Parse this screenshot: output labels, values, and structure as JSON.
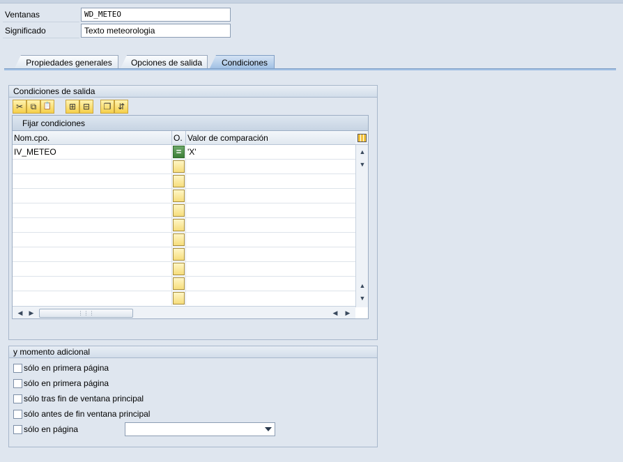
{
  "header": {
    "fields": [
      {
        "label": "Ventanas",
        "value": "WD_METEO"
      },
      {
        "label": "Significado",
        "value": "Texto meteorologia"
      }
    ]
  },
  "tabs": [
    {
      "label": "Propiedades generales",
      "active": false
    },
    {
      "label": "Opciones de salida",
      "active": false
    },
    {
      "label": "Condiciones",
      "active": true
    }
  ],
  "conditions": {
    "group_title": "Condiciones de salida",
    "toolbar": [
      {
        "name": "cut-icon",
        "glyph": "✂"
      },
      {
        "name": "copy-icon",
        "glyph": "⧉"
      },
      {
        "name": "paste-icon",
        "glyph": "📋"
      },
      {
        "name": "insert-row-icon",
        "glyph": "⊞"
      },
      {
        "name": "delete-row-icon",
        "glyph": "⊟"
      },
      {
        "name": "duplicate-icon",
        "glyph": "❐"
      },
      {
        "name": "move-icon",
        "glyph": "⇵"
      }
    ],
    "grid": {
      "title": "Fijar condiciones",
      "columns": [
        "Nom.cpo.",
        "O.",
        "Valor de comparación"
      ],
      "rows": [
        {
          "field": "IV_METEO",
          "op": "=",
          "value": "'X'"
        },
        {
          "field": "",
          "op": "",
          "value": ""
        },
        {
          "field": "",
          "op": "",
          "value": ""
        },
        {
          "field": "",
          "op": "",
          "value": ""
        },
        {
          "field": "",
          "op": "",
          "value": ""
        },
        {
          "field": "",
          "op": "",
          "value": ""
        },
        {
          "field": "",
          "op": "",
          "value": ""
        },
        {
          "field": "",
          "op": "",
          "value": ""
        },
        {
          "field": "",
          "op": "",
          "value": ""
        },
        {
          "field": "",
          "op": "",
          "value": ""
        },
        {
          "field": "",
          "op": "",
          "value": ""
        }
      ]
    }
  },
  "moment": {
    "group_title": "y momento adicional",
    "options": [
      {
        "label": "sólo en primera página",
        "checked": false
      },
      {
        "label": "sólo en primera página",
        "checked": false
      },
      {
        "label": "sólo tras fin de ventana principal",
        "checked": false
      },
      {
        "label": "sólo antes de fin ventana principal",
        "checked": false
      },
      {
        "label": "sólo en página",
        "checked": false
      }
    ],
    "page_select_value": ""
  }
}
